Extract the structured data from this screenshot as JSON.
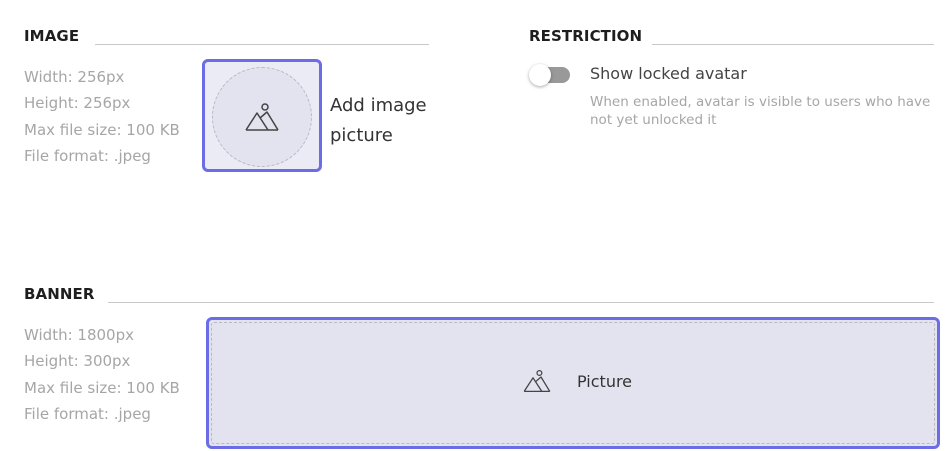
{
  "image_section": {
    "title": "IMAGE",
    "specs": [
      "Width: 256px",
      "Height: 256px",
      "Max file size: 100 KB",
      "File format: .jpeg"
    ],
    "upload_label": "Add image picture",
    "upload_icon": "image-placeholder-icon"
  },
  "restriction_section": {
    "title": "RESTRICTION",
    "toggle_label": "Show locked avatar",
    "toggle_state": "off",
    "description": "When enabled, avatar is visible to users who have not yet unlocked it"
  },
  "banner_section": {
    "title": "BANNER",
    "specs": [
      "Width: 1800px",
      "Height: 300px",
      "Max file size: 100 KB",
      "File format: .jpeg"
    ],
    "upload_label": "Picture",
    "upload_icon": "image-placeholder-icon"
  },
  "colors": {
    "accent_border": "#6c6ce6",
    "upload_fill": "#e3e3ef",
    "muted_text": "#a6a6a6"
  }
}
